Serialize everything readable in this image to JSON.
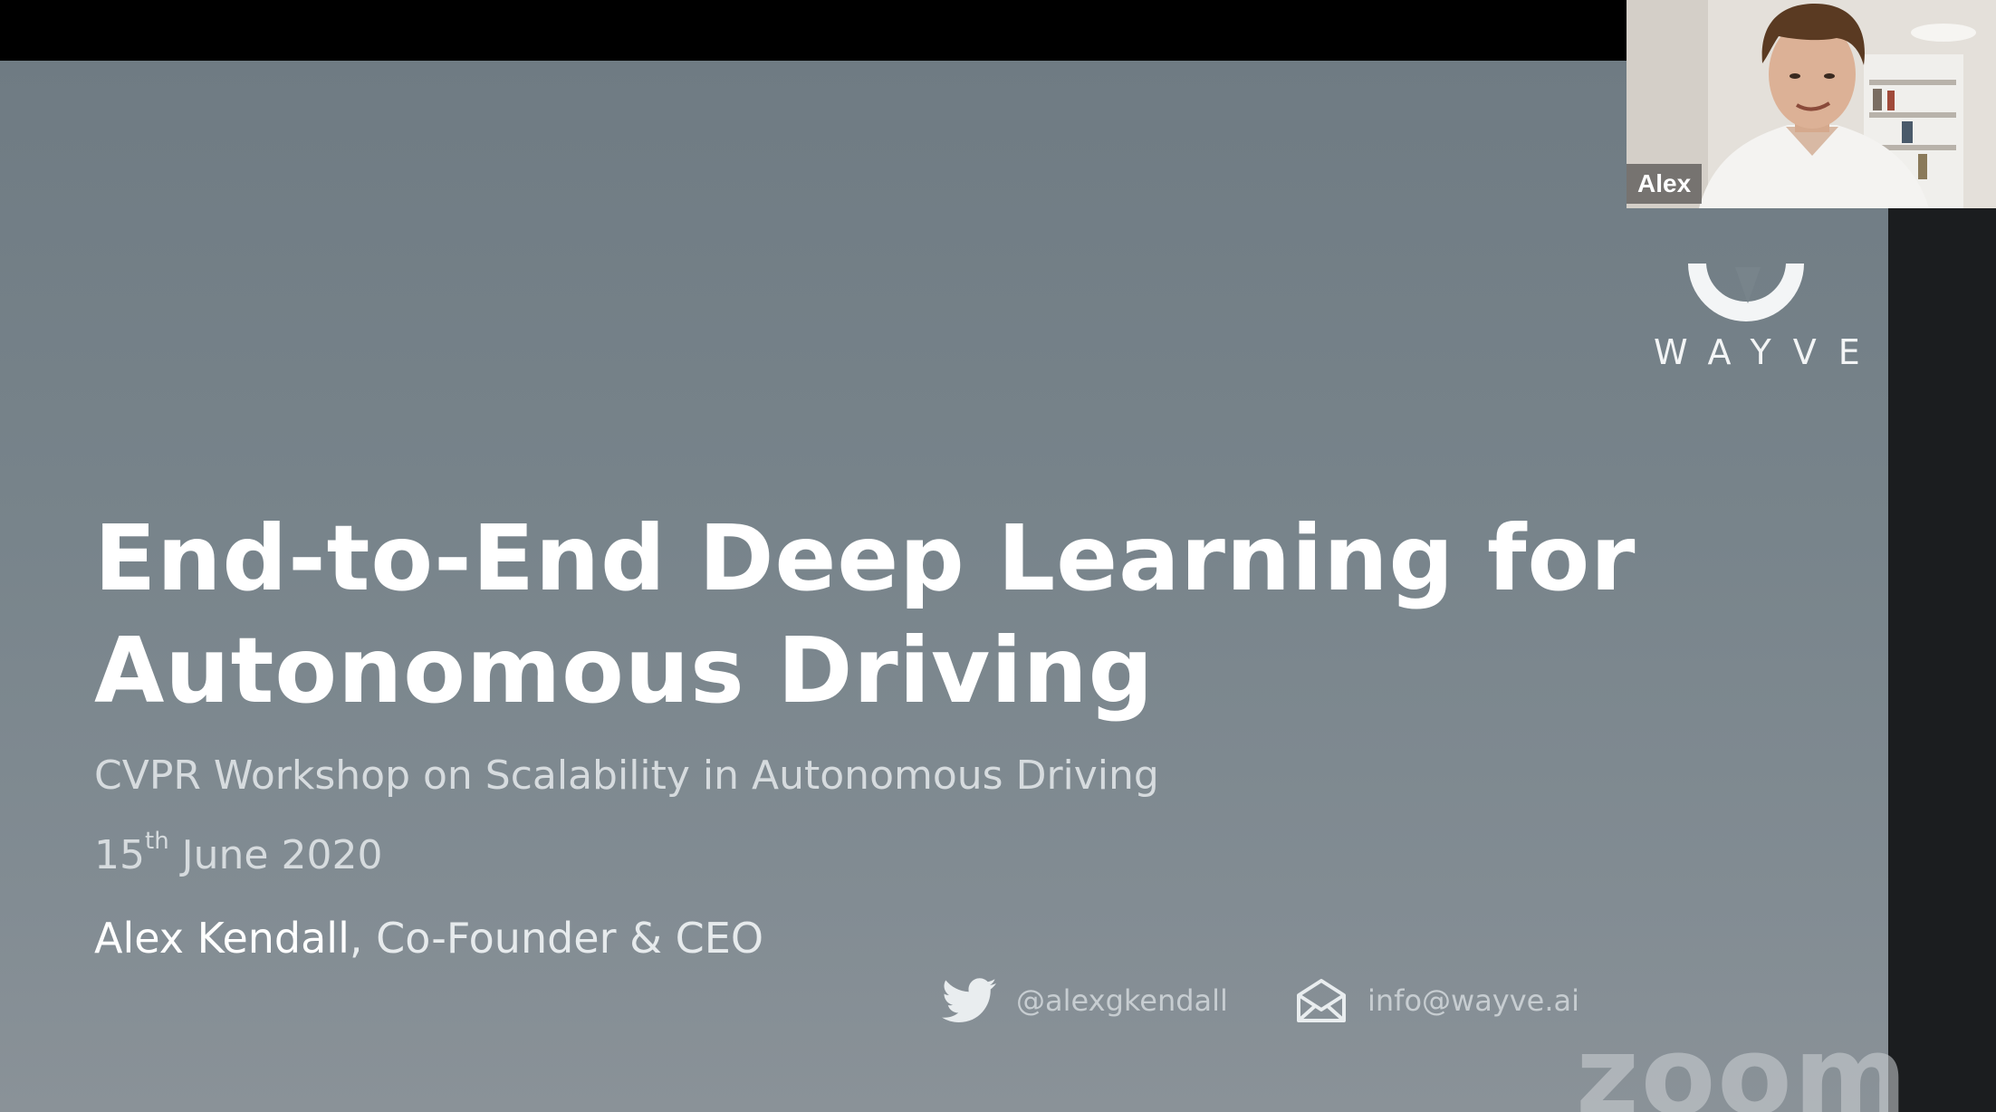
{
  "slide": {
    "title_line1": "End-to-End Deep Learning for",
    "title_line2": "Autonomous Driving",
    "subtitle": "CVPR Workshop on Scalability in Autonomous Driving",
    "date_day": "15",
    "date_suffix": "th",
    "date_rest": " June 2020",
    "author_name": "Alex Kendall",
    "author_role": ", Co-Founder & CEO",
    "twitter_handle": "@alexgkendall",
    "email": "info@wayve.ai",
    "logo_wordmark": "WAYVE"
  },
  "participant": {
    "name": "Alex"
  },
  "watermark": {
    "text": "zoom"
  },
  "icons": {
    "twitter": "twitter-bird-icon",
    "email": "envelope-icon",
    "logo": "wayve-logo-icon"
  },
  "colors": {
    "slide_bg": "#78848b",
    "title_text": "#ffffff",
    "secondary_text": "#d6dbde"
  }
}
